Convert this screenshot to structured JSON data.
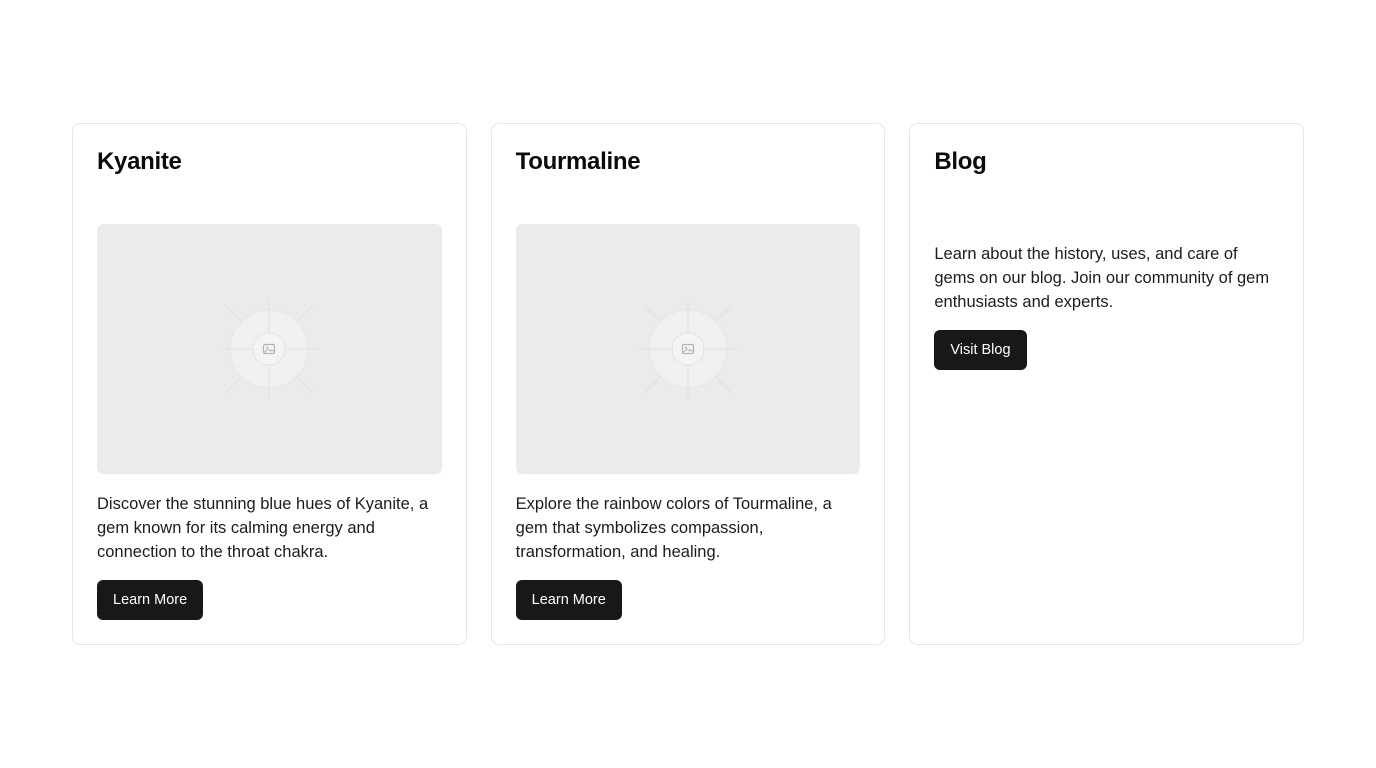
{
  "cards": [
    {
      "title": "Kyanite",
      "has_image": true,
      "image_icon": "image-placeholder-icon",
      "description": "Discover the stunning blue hues of Kyanite, a gem known for its calming energy and connection to the throat chakra.",
      "button_label": "Learn More"
    },
    {
      "title": "Tourmaline",
      "has_image": true,
      "image_icon": "image-placeholder-icon",
      "description": "Explore the rainbow colors of Tourmaline, a gem that symbolizes compassion, transformation, and healing.",
      "button_label": "Learn More"
    },
    {
      "title": "Blog",
      "has_image": false,
      "description": "Learn about the history, uses, and care of gems on our blog. Join our community of gem enthusiasts and experts.",
      "button_label": "Visit Blog"
    }
  ],
  "colors": {
    "button_bg": "#18181b",
    "button_text": "#ffffff",
    "card_border": "#e5e5e7",
    "image_bg": "#ebebeb"
  }
}
